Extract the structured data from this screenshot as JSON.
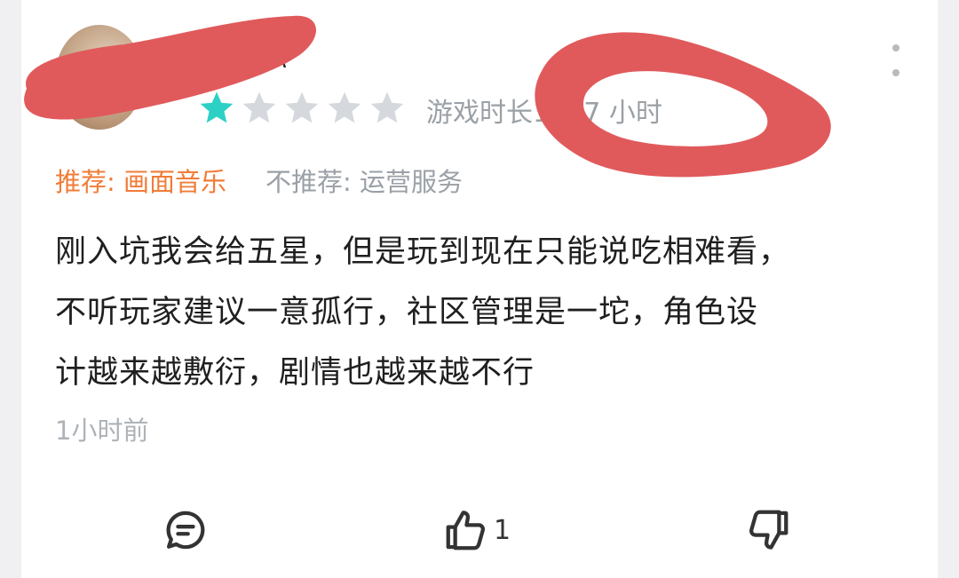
{
  "review": {
    "username_visible": "\\",
    "rating": 1,
    "max_rating": 5,
    "star_filled_color": "#2dd0c4",
    "star_empty_color": "#d5d9dd",
    "playtime": "游戏时长1237 小时",
    "recommend_label": "推荐: 画面音乐",
    "not_recommend_label": "不推荐: 运营服务",
    "text_lines": [
      "刚入坑我会给五星，但是玩到现在只能说吃相难看，",
      "不听玩家建议一意孤行，社区管理是一坨，角色设",
      "计越来越敷衍，剧情也越来越不行"
    ],
    "posted_time": "1小时前",
    "like_count": "1"
  },
  "icons": {
    "more": "more-vertical-icon",
    "comment": "comment-icon",
    "like": "thumbs-up-icon",
    "dislike": "thumbs-down-icon"
  },
  "colors": {
    "recommend": "#f07c37",
    "muted": "#9aa0a6",
    "redaction": "#e05a5c"
  }
}
